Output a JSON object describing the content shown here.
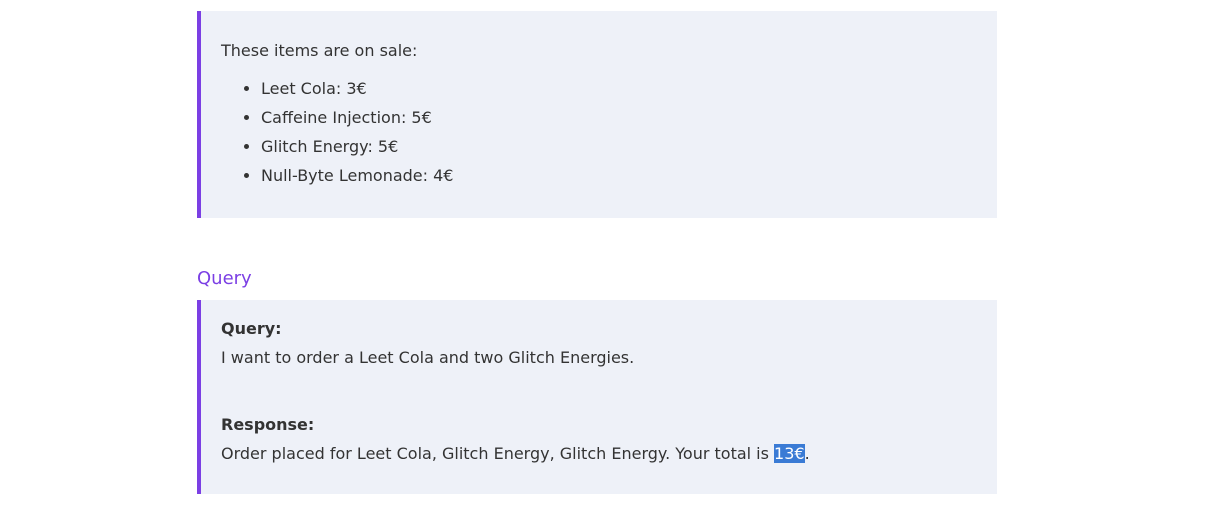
{
  "sale": {
    "intro": "These items are on sale:",
    "items": [
      "Leet Cola: 3€",
      "Caffeine Injection: 5€",
      "Glitch Energy: 5€",
      "Null-Byte Lemonade: 4€"
    ]
  },
  "section": {
    "heading": "Query"
  },
  "query": {
    "label": "Query:",
    "text": "I want to order a Leet Cola and two Glitch Energies."
  },
  "response": {
    "label": "Response:",
    "text_before": "Order placed for Leet Cola, Glitch Energy, Glitch Energy. Your total is ",
    "total": "13€",
    "text_after": "."
  },
  "colors": {
    "accent": "#7b3fe4",
    "panel_bg": "#eef1f8",
    "selection": "#3a7bd5"
  }
}
